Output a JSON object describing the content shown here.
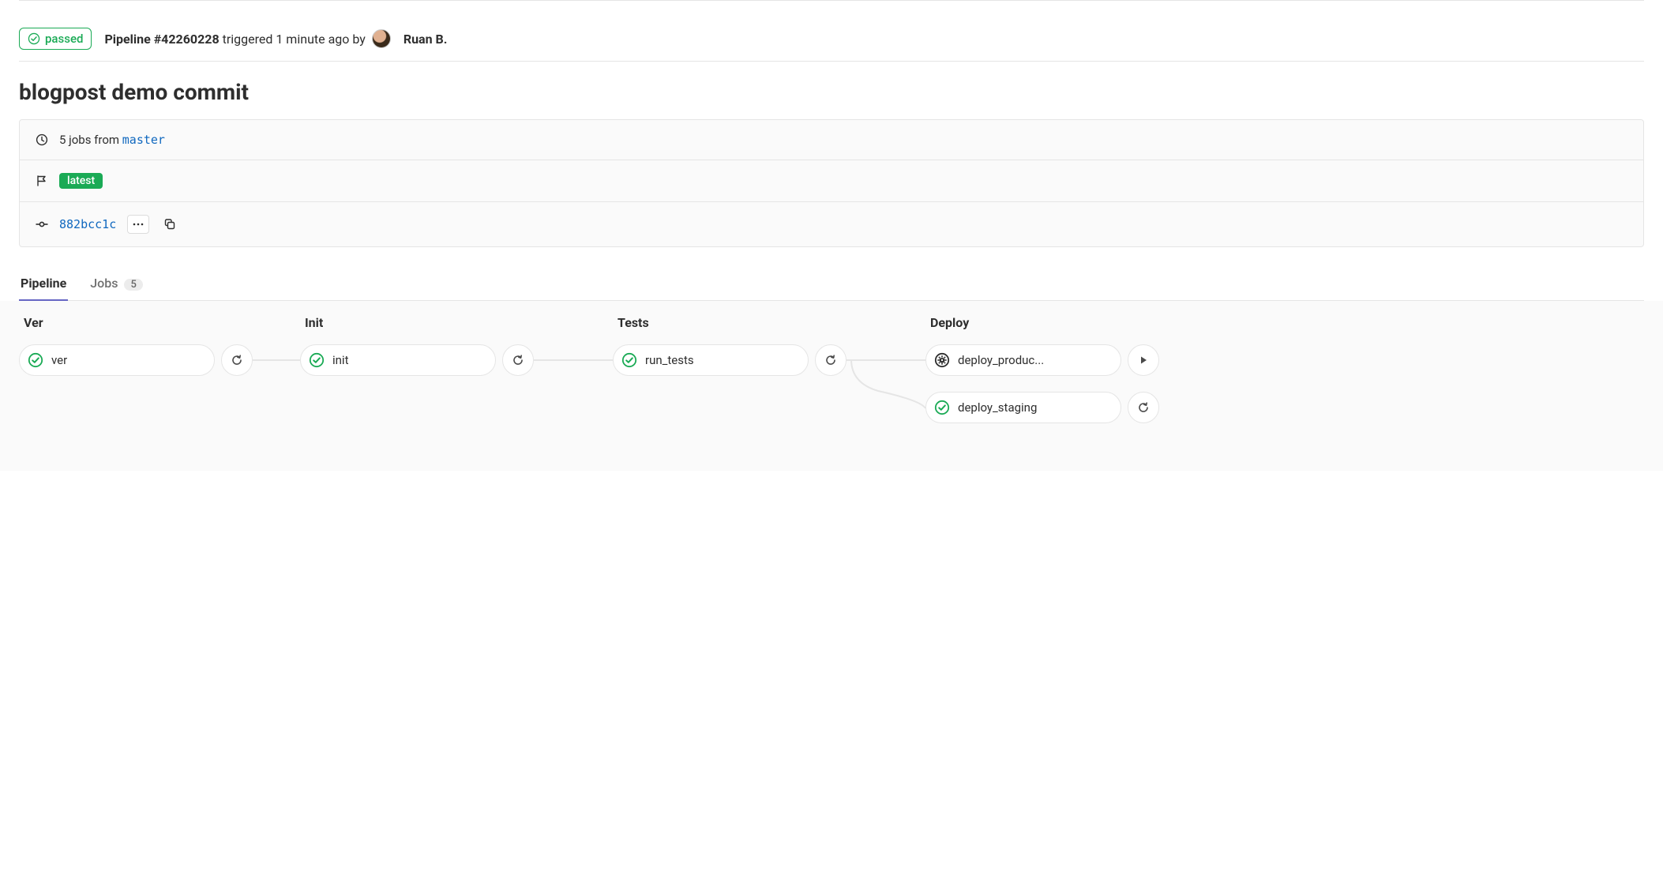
{
  "header": {
    "status_label": "passed",
    "pipeline_prefix": "Pipeline ",
    "pipeline_id": "#42260228",
    "triggered_text": " triggered 1 minute ago by",
    "user_name": "Ruan B."
  },
  "commit": {
    "title": "blogpost demo commit"
  },
  "info": {
    "jobs_text_prefix": "5 jobs from ",
    "branch": "master",
    "tag_label": "latest",
    "commit_sha": "882bcc1c"
  },
  "tabs": {
    "pipeline_label": "Pipeline",
    "jobs_label": "Jobs",
    "jobs_count": "5"
  },
  "stages": [
    {
      "name": "Ver",
      "jobs": [
        {
          "name": "ver",
          "status": "success",
          "action": "retry"
        }
      ]
    },
    {
      "name": "Init",
      "jobs": [
        {
          "name": "init",
          "status": "success",
          "action": "retry"
        }
      ]
    },
    {
      "name": "Tests",
      "jobs": [
        {
          "name": "run_tests",
          "status": "success",
          "action": "retry"
        }
      ]
    },
    {
      "name": "Deploy",
      "jobs": [
        {
          "name": "deploy_produc...",
          "status": "manual",
          "action": "play"
        },
        {
          "name": "deploy_staging",
          "status": "success",
          "action": "retry"
        }
      ]
    }
  ]
}
